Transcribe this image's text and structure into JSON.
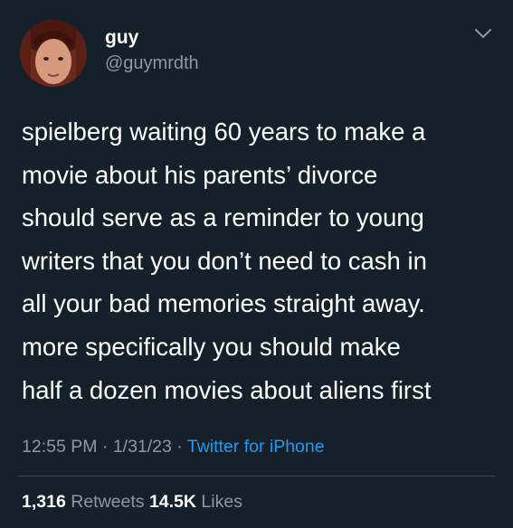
{
  "author": {
    "display_name": "guy",
    "handle": "@guymrdth",
    "avatar_icon": "profile-photo-avatar"
  },
  "menu_icon": "chevron-down-icon",
  "tweet": {
    "lines": [
      "spielberg waiting 60 years to make a",
      "movie about his parents’ divorce",
      "should serve as a reminder to young",
      "writers that you don’t need to cash in",
      "all your bad memories straight away.",
      "more specifically you should make",
      "half a dozen movies about aliens first"
    ]
  },
  "meta": {
    "time": "12:55 PM",
    "separator": " · ",
    "date": "1/31/23",
    "source": "Twitter for iPhone"
  },
  "stats": {
    "retweets_count": "1,316",
    "retweets_label": "Retweets",
    "likes_count": "14.5K",
    "likes_label": "Likes"
  },
  "colors": {
    "background": "#15202b",
    "primary_text": "#ffffff",
    "secondary_text": "#8b98a5",
    "link": "#1d9bf0",
    "divider": "#38444d"
  }
}
